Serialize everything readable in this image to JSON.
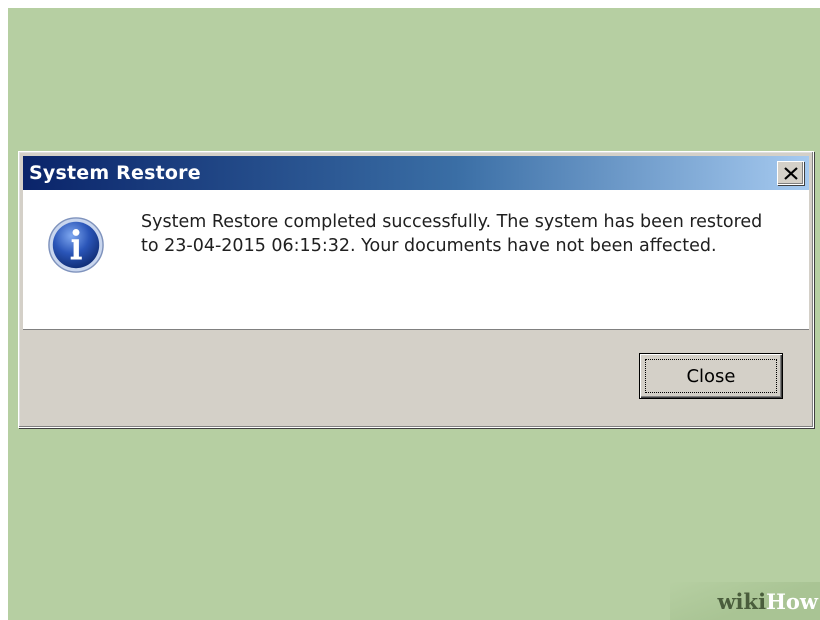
{
  "dialog": {
    "title": "System Restore",
    "close_glyph": "✕",
    "icon": "information-icon",
    "message": "System Restore completed successfully. The system has been restored to 23-04-2015 06:15:32. Your documents have not been affected.",
    "close_button_label": "Close"
  },
  "watermark": {
    "part1": "wiki",
    "part2": "How"
  },
  "colors": {
    "background": "#b6cfa2",
    "title_bar_start": "#0a246a",
    "title_bar_end": "#a6caf0",
    "dialog_face": "#d4d0c8",
    "info_icon": "#2a55b8"
  }
}
